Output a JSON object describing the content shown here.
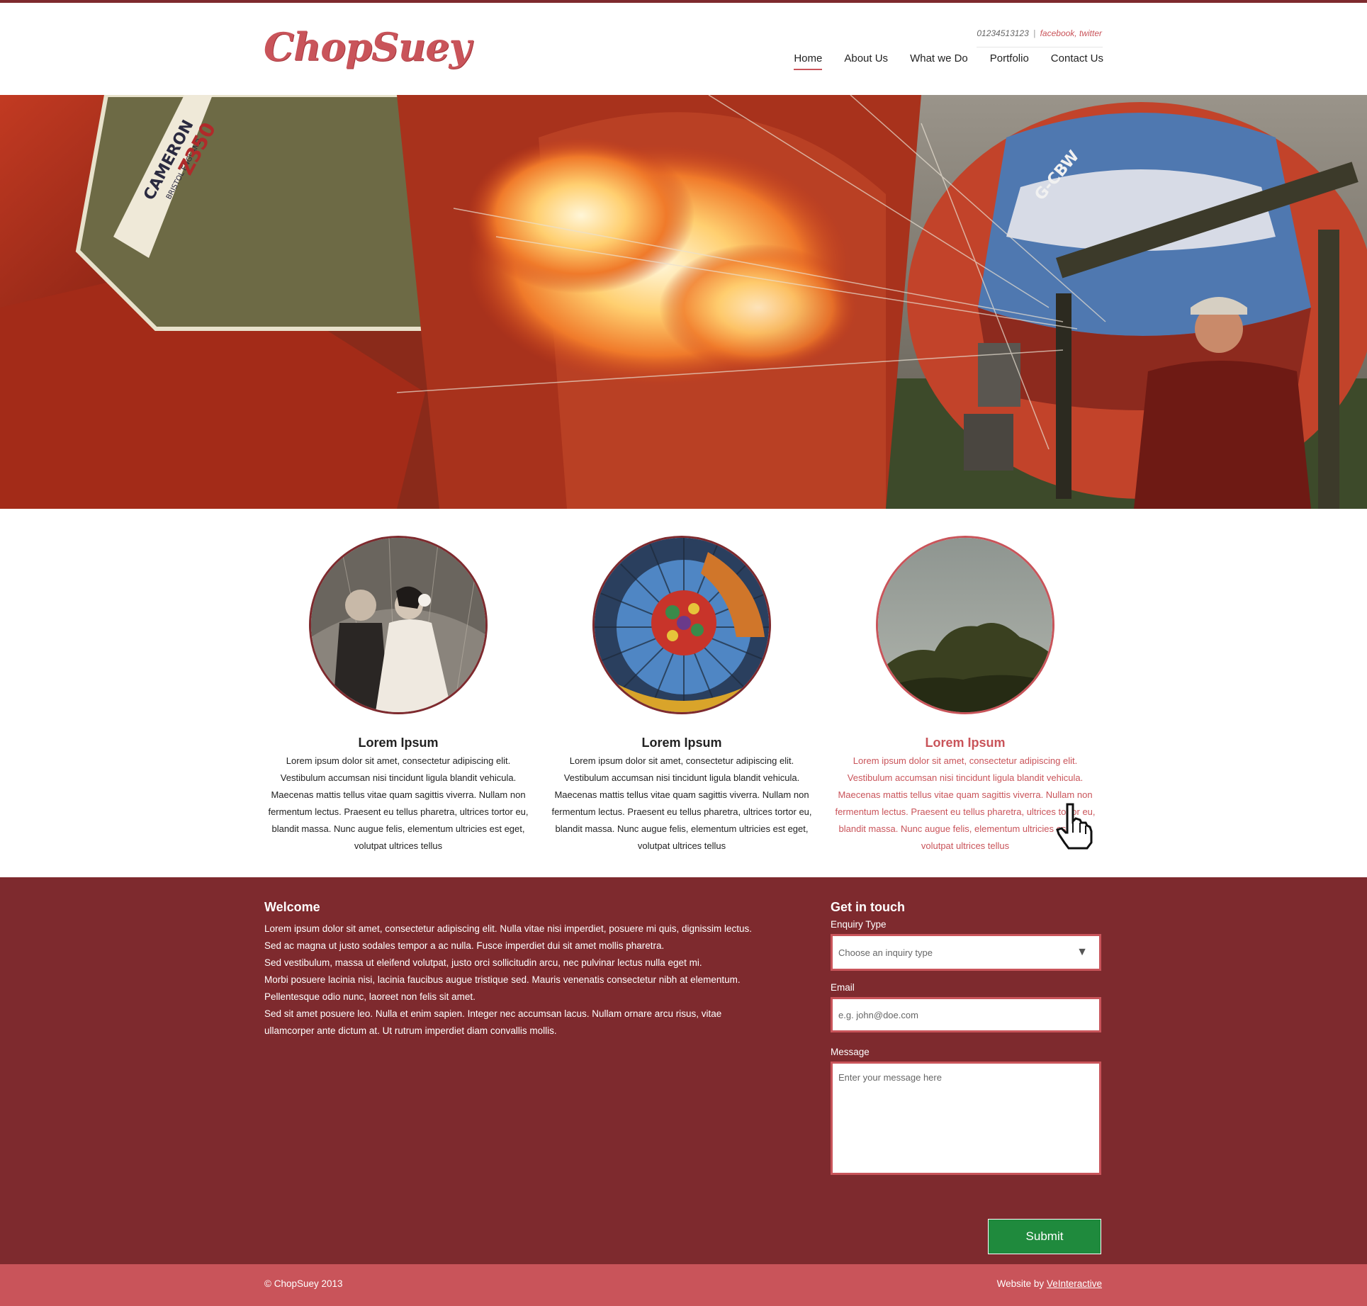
{
  "header": {
    "logo": "ChopSuey",
    "phone": "01234513123",
    "separator": "|",
    "facebook": "facebook,",
    "twitter": "twitter",
    "nav": [
      {
        "label": "Home",
        "active": true
      },
      {
        "label": "About Us"
      },
      {
        "label": "What we Do"
      },
      {
        "label": "Portfolio"
      },
      {
        "label": "Contact Us"
      }
    ]
  },
  "hero": {
    "balloon_text_1": "CAMERON",
    "balloon_text_2": "BRISTOL ENGLAND",
    "balloon_text_3": "Z350",
    "balloon_reg": "G-CBW"
  },
  "features": [
    {
      "title": "Lorem Ipsum",
      "text": "Lorem ipsum dolor sit amet, consectetur adipiscing elit. Vestibulum accumsan nisi tincidunt ligula blandit vehicula. Maecenas mattis tellus vitae quam sagittis viverra. Nullam non fermentum lectus. Praesent eu tellus pharetra, ultrices tortor eu, blandit massa. Nunc augue felis, elementum ultricies est eget, volutpat ultrices tellus"
    },
    {
      "title": "Lorem Ipsum",
      "text": "Lorem ipsum dolor sit amet, consectetur adipiscing elit. Vestibulum accumsan nisi tincidunt ligula blandit vehicula. Maecenas mattis tellus vitae quam sagittis viverra. Nullam non fermentum lectus. Praesent eu tellus pharetra, ultrices tortor eu, blandit massa. Nunc augue felis, elementum ultricies est eget, volutpat ultrices tellus"
    },
    {
      "title": "Lorem Ipsum",
      "text": "Lorem ipsum dolor sit amet, consectetur adipiscing elit. Vestibulum accumsan nisi tincidunt ligula blandit vehicula. Maecenas mattis tellus vitae quam sagittis viverra. Nullam non fermentum lectus. Praesent eu tellus pharetra, ultrices tortor eu, blandit massa. Nunc augue felis, elementum ultricies est eget, volutpat ultrices tellus"
    }
  ],
  "welcome": {
    "title": "Welcome",
    "lines": [
      "Lorem ipsum dolor sit amet, consectetur adipiscing elit.  Nulla vitae nisi imperdiet, posuere mi quis, dignissim lectus.",
      "Sed ac magna ut justo sodales tempor a ac nulla. Fusce imperdiet dui sit amet mollis pharetra.",
      "Sed vestibulum, massa ut eleifend volutpat, justo orci sollicitudin arcu, nec pulvinar lectus nulla eget mi.",
      "Morbi posuere lacinia nisi, lacinia faucibus augue tristique sed. Mauris venenatis consectetur nibh at elementum.",
      "Pellentesque odio nunc, laoreet non felis sit amet.",
      "Sed sit amet posuere leo. Nulla et enim sapien. Integer nec accumsan lacus. Nullam ornare arcu risus, vitae",
      "ullamcorper ante dictum at. Ut rutrum imperdiet diam convallis mollis."
    ]
  },
  "contact_form": {
    "title": "Get in touch",
    "enquiry_label": "Enquiry Type",
    "enquiry_value": "Choose an inquiry type",
    "email_label": "Email",
    "email_placeholder": "e.g. john@doe.com",
    "message_label": "Message",
    "message_placeholder": "Enter your message here",
    "submit_label": "Submit"
  },
  "footer": {
    "copyright": "© ChopSuey 2013",
    "credit_prefix": "Website by",
    "credit_link": "VeInteractive"
  },
  "colors": {
    "brand": "#c9545a",
    "dark_band": "#7e2a2e",
    "submit": "#1f8a3d"
  }
}
